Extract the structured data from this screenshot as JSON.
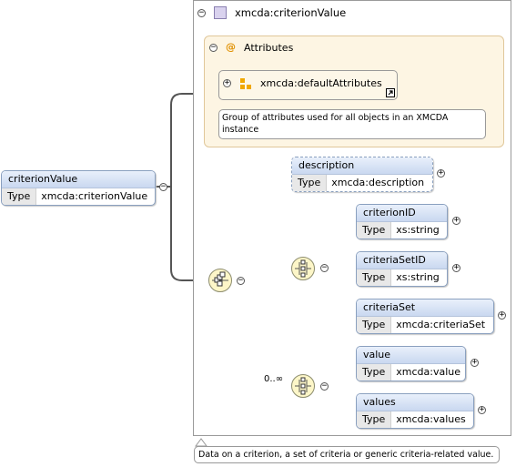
{
  "root": {
    "name": "criterionValue",
    "type_label": "Type",
    "type_value": "xmcda:criterionValue"
  },
  "complex_type": {
    "name": "xmcda:criterionValue"
  },
  "attributes": {
    "label": "Attributes",
    "at_icon": "@"
  },
  "attribute_group": {
    "name": "xmcda:defaultAttributes",
    "doc": "Group of attributes used for all objects in an XMCDA instance"
  },
  "description": {
    "name": "description",
    "type_label": "Type",
    "type_value": "xmcda:description"
  },
  "criterion_id": {
    "name": "criterionID",
    "type_label": "Type",
    "type_value": "xs:string"
  },
  "criteria_set_id": {
    "name": "criteriaSetID",
    "type_label": "Type",
    "type_value": "xs:string"
  },
  "criteria_set": {
    "name": "criteriaSet",
    "type_label": "Type",
    "type_value": "xmcda:criteriaSet"
  },
  "value": {
    "name": "value",
    "type_label": "Type",
    "type_value": "xmcda:value"
  },
  "values": {
    "name": "values",
    "type_label": "Type",
    "type_value": "xmcda:values"
  },
  "occurrence": "0..∞",
  "root_doc": "Data on a criterion, a set of criteria or generic criteria-related value.",
  "colors": {
    "element_header": "#c9d8f0",
    "attribute_panel": "#fdf5e3",
    "compositor": "#fdf6c8",
    "group_icon": "#f0a800"
  }
}
